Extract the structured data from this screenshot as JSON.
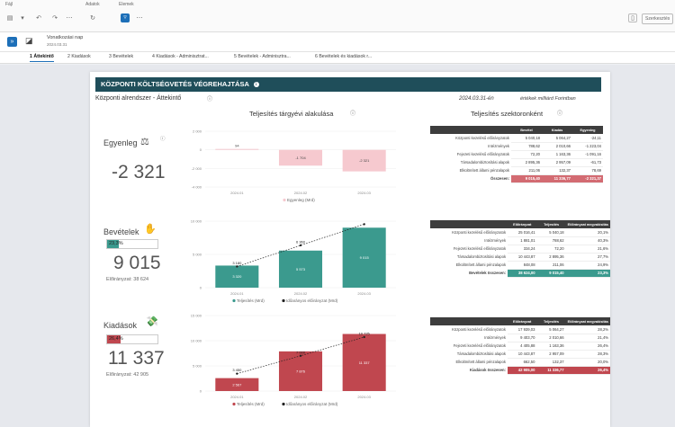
{
  "toolbar": {
    "file_label": "Fájl",
    "data_label": "Adatok",
    "elements_label": "Elemek",
    "share_label": "Szerkesztés"
  },
  "app": {
    "title": "Vonatkozási nap",
    "date": "2024.03.31"
  },
  "tabs": [
    "1 Áttekintő",
    "2 Kiadások",
    "3 Bevételek",
    "4 Kiadások - Adminisztrat...",
    "5 Bevételek - Adminisztra...",
    "6 Bevételek és kiadások r..."
  ],
  "report": {
    "title": "KÖZPONTI KÖLTSÉGVETÉS VÉGREHAJTÁSA",
    "subtitle": "Központi alrendszer - Áttekintő",
    "date": "2024.03.31-én",
    "unit": "értékek milliárd Forintban",
    "chart_heading": "Teljesítés tárgyévi alakulása",
    "sector_heading": "Teljesítés szektoronként"
  },
  "cards": {
    "egyenleg": {
      "label": "Egyenleg",
      "value": "-2 321"
    },
    "bevetelek": {
      "label": "Bevételek",
      "value": "9 015",
      "pct": "23,3%",
      "pct_value": 0.233,
      "plan": "Előirányzat: 38 624"
    },
    "kiadasok": {
      "label": "Kiadások",
      "value": "11 337",
      "pct": "26,4%",
      "pct_value": 0.264,
      "plan": "Előirányzat: 42 905"
    }
  },
  "chart_data": [
    {
      "type": "bar",
      "categories": [
        "2024.01",
        "2024.02",
        "2024.03"
      ],
      "series": [
        {
          "name": "Egyenleg (Mrd)",
          "values": [
            94,
            -1704,
            -2321
          ]
        }
      ],
      "ylim": [
        -4000,
        2000
      ],
      "yticks": [
        "2 000",
        "0",
        "-2 000",
        "-4 000"
      ],
      "data_labels": [
        "94",
        "-1 704",
        "-2 321"
      ],
      "color": "#f6c9cf"
    },
    {
      "type": "bar",
      "categories": [
        "2024.01",
        "2024.02",
        "2024.03"
      ],
      "series": [
        {
          "name": "Teljesítés (Mrd)",
          "values": [
            3320,
            5573,
            9015
          ]
        },
        {
          "name": "Időarányos előirányzat (Mrd)",
          "values": [
            3180,
            6360,
            9540
          ]
        }
      ],
      "ylim": [
        0,
        10000
      ],
      "yticks": [
        "10 000",
        "5 000",
        "0"
      ],
      "data_labels": [
        "3 320",
        "5 573",
        "9 015"
      ],
      "line_labels": [
        "3 180",
        "6 360",
        ""
      ],
      "color": "#3b9a8e"
    },
    {
      "type": "bar",
      "categories": [
        "2024.01",
        "2024.02",
        "2024.03"
      ],
      "series": [
        {
          "name": "Teljesítés (Mrd)",
          "values": [
            2567,
            7876,
            11337
          ]
        },
        {
          "name": "Időarányos előirányzat (Mrd)",
          "values": [
            3450,
            7000,
            10725
          ]
        }
      ],
      "ylim": [
        0,
        15000
      ],
      "yticks": [
        "15 000",
        "10 000",
        "5 000",
        "0"
      ],
      "data_labels": [
        "2 567",
        "7 876",
        "11 337"
      ],
      "line_labels": [
        "3 450",
        "7 000",
        "10 725"
      ],
      "color": "#c0474f"
    }
  ],
  "tables": {
    "egyenleg": {
      "headers": [
        "Bevétel",
        "Kiadás",
        "Egyenleg"
      ],
      "rows": [
        [
          "Központi kezelésű előirányzatok",
          "5 040,18",
          "5 064,27",
          "-24,11"
        ],
        [
          "Intézmények",
          "788,62",
          "2 010,66",
          "-1 223,04"
        ],
        [
          "Fejezeti kezelésű előirányzatok",
          "72,20",
          "1 163,36",
          "-1 091,16"
        ],
        [
          "Társadalombiztosítási alapok",
          "2 895,36",
          "2 957,09",
          "-61,73"
        ],
        [
          "Elkülönített állami pénzalapok",
          "211,06",
          "132,37",
          "78,69"
        ]
      ],
      "total": [
        "Összesen:",
        "9 015,40",
        "11 336,77",
        "-2 321,37"
      ]
    },
    "bevetelek": {
      "headers": [
        "Előirányzat",
        "Teljesítés",
        "Előirányzat megvalósítás"
      ],
      "rows": [
        [
          "Központi kezelésű előirányzatok",
          "25 016,41",
          "5 040,18",
          "20,1%"
        ],
        [
          "Intézmények",
          "1 881,01",
          "788,62",
          "40,3%"
        ],
        [
          "Fejezeti kezelésű előirányzatok",
          "334,24",
          "72,20",
          "21,6%"
        ],
        [
          "Társadalombiztosítási alapok",
          "10 443,87",
          "2 895,36",
          "27,7%"
        ],
        [
          "Elkülönített állami pénzalapok",
          "848,08",
          "211,06",
          "24,9%"
        ]
      ],
      "total": [
        "Bevételek összesen:",
        "38 624,00",
        "9 015,40",
        "23,3%"
      ]
    },
    "kiadasok": {
      "headers": [
        "Előirányzat",
        "Teljesítés",
        "Előirányzat megvalósítás"
      ],
      "rows": [
        [
          "Központi kezelésű előirányzatok",
          "17 939,03",
          "5 064,27",
          "28,2%"
        ],
        [
          "Intézmények",
          "9 403,70",
          "2 010,66",
          "21,4%"
        ],
        [
          "Fejezeti kezelésű előirányzatok",
          "4 405,88",
          "1 163,36",
          "26,4%"
        ],
        [
          "Társadalombiztosítási alapok",
          "10 443,87",
          "2 957,09",
          "28,3%"
        ],
        [
          "Elkülönített állami pénzalapok",
          "662,50",
          "132,37",
          "20,0%"
        ]
      ],
      "total": [
        "Kiadások összesen:",
        "42 905,00",
        "11 336,77",
        "26,4%"
      ]
    }
  },
  "colors": {
    "header": "#1f4e5a",
    "teal": "#3b9a8e",
    "red": "#c0474f",
    "pink": "#f6c9cf"
  }
}
